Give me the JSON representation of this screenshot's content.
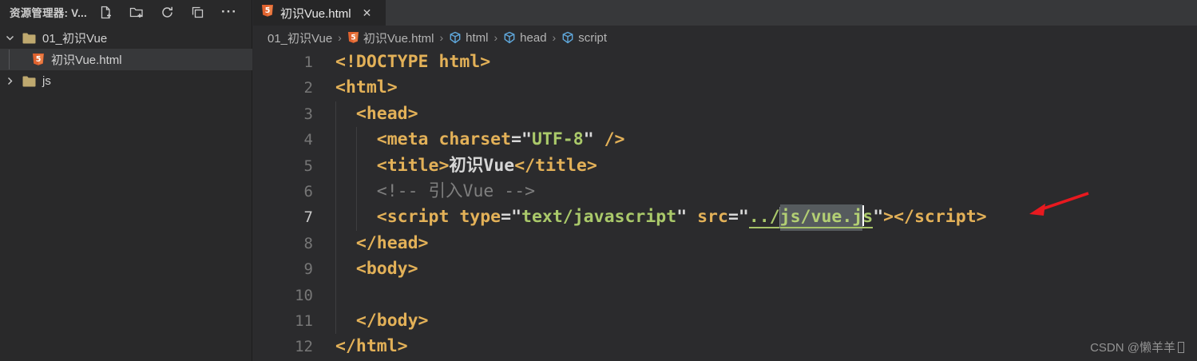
{
  "explorer": {
    "title": "资源管理器: V...",
    "actions": {
      "new_file": "new-file",
      "new_folder": "new-folder",
      "refresh": "refresh",
      "collapse_all": "collapse-all",
      "more": "···"
    },
    "tree": [
      {
        "label": "01_初识Vue",
        "type": "folder",
        "state": "expanded"
      },
      {
        "label": "初识Vue.html",
        "type": "html-file",
        "selected": true
      },
      {
        "label": "js",
        "type": "folder",
        "state": "collapsed"
      }
    ]
  },
  "tab": {
    "label": "初识Vue.html",
    "close": "✕"
  },
  "breadcrumb": {
    "separator": "›",
    "items": [
      {
        "label": "01_初识Vue"
      },
      {
        "label": "初识Vue.html",
        "icon": "html"
      },
      {
        "label": "html",
        "icon": "symbol-cube"
      },
      {
        "label": "head",
        "icon": "symbol-cube"
      },
      {
        "label": "script",
        "icon": "symbol-cube"
      }
    ]
  },
  "editor": {
    "active_line": "7",
    "lines": [
      {
        "num": "1",
        "tokens": [
          [
            "tag",
            "<!DOCTYPE html>"
          ]
        ]
      },
      {
        "num": "2",
        "tokens": [
          [
            "tag",
            "<html>"
          ]
        ]
      },
      {
        "num": "3",
        "tokens": [
          [
            "pln",
            "  "
          ],
          [
            "tag",
            "<head>"
          ]
        ]
      },
      {
        "num": "4",
        "tokens": [
          [
            "pln",
            "    "
          ],
          [
            "tag",
            "<meta charset"
          ],
          [
            "pun",
            "=\""
          ],
          [
            "str",
            "UTF-8"
          ],
          [
            "pun",
            "\""
          ],
          [
            "pln",
            " "
          ],
          [
            "tag",
            "/>"
          ]
        ]
      },
      {
        "num": "5",
        "tokens": [
          [
            "pln",
            "    "
          ],
          [
            "tag",
            "<title>"
          ],
          [
            "pln",
            "初识Vue"
          ],
          [
            "tag",
            "</title>"
          ]
        ]
      },
      {
        "num": "6",
        "tokens": [
          [
            "pln",
            "    "
          ],
          [
            "com",
            "<!-- 引入Vue -->"
          ]
        ]
      },
      {
        "num": "7",
        "tokens": [
          [
            "pln",
            "    "
          ],
          [
            "tag",
            "<script type"
          ],
          [
            "pun",
            "=\""
          ],
          [
            "str",
            "text/javascript"
          ],
          [
            "pun",
            "\""
          ],
          [
            "pln",
            " "
          ],
          [
            "tag",
            "src"
          ],
          [
            "pun",
            "=\""
          ],
          [
            "lnk",
            "../"
          ],
          [
            "sel",
            "js/vue.j"
          ],
          [
            "cur",
            ""
          ],
          [
            "lnk",
            "s"
          ],
          [
            "pun",
            "\""
          ],
          [
            "tag",
            "></script>"
          ]
        ]
      },
      {
        "num": "8",
        "tokens": [
          [
            "pln",
            "  "
          ],
          [
            "tag",
            "</head>"
          ]
        ]
      },
      {
        "num": "9",
        "tokens": [
          [
            "pln",
            "  "
          ],
          [
            "tag",
            "<body>"
          ]
        ]
      },
      {
        "num": "10",
        "tokens": []
      },
      {
        "num": "11",
        "tokens": [
          [
            "pln",
            "  "
          ],
          [
            "tag",
            "</body>"
          ]
        ]
      },
      {
        "num": "12",
        "tokens": [
          [
            "tag",
            "</html>"
          ]
        ]
      }
    ]
  },
  "watermark": "CSDN @懒羊羊",
  "colors": {
    "tag_gold": "#e3b158",
    "string_green": "#aac96a",
    "comment_gray": "#7f7f7f",
    "html_icon_orange": "#e0622f",
    "symbol_icon_blue": "#5fa8dc",
    "annotation_arrow_red": "#e8191f",
    "selection_gray": "#565b5e",
    "tabstrip_bg": "#37383a",
    "editor_bg": "#2b2b2d",
    "sidebar_bg": "#29292a"
  }
}
